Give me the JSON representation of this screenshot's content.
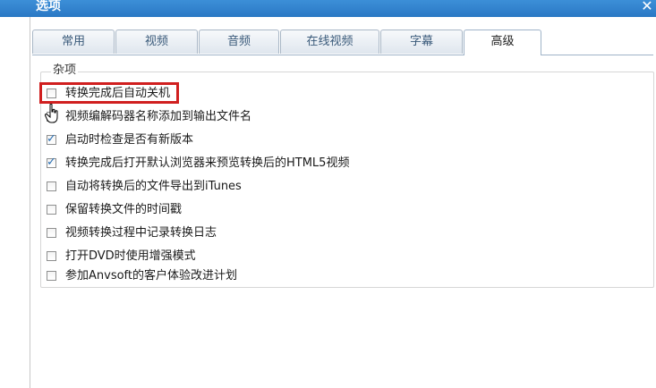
{
  "window": {
    "title": "选项",
    "close_glyph": "✕"
  },
  "tabs": [
    {
      "label": "常用",
      "active": false
    },
    {
      "label": "视频",
      "active": false
    },
    {
      "label": "音频",
      "active": false
    },
    {
      "label": "在线视频",
      "active": false
    },
    {
      "label": "字幕",
      "active": false
    },
    {
      "label": "高级",
      "active": true
    }
  ],
  "group": {
    "label": "杂项",
    "options": [
      {
        "label": "转换完成后自动关机",
        "checked": false
      },
      {
        "label": "视频编解码器名称添加到输出文件名",
        "checked": false
      },
      {
        "label": "启动时检查是否有新版本",
        "checked": true
      },
      {
        "label": "转换完成后打开默认浏览器来预览转换后的HTML5视频",
        "checked": true
      },
      {
        "label": "自动将转换后的文件导出到iTunes",
        "checked": false
      },
      {
        "label": "保留转换文件的时间戳",
        "checked": false
      },
      {
        "label": "视频转换过程中记录转换日志",
        "checked": false
      },
      {
        "label": "打开DVD时使用增强模式",
        "checked": false
      },
      {
        "label": "参加Anvsoft的客户体验改进计划",
        "checked": false
      }
    ]
  },
  "colors": {
    "accent": "#2a78c4",
    "highlight": "#d01f1f"
  }
}
